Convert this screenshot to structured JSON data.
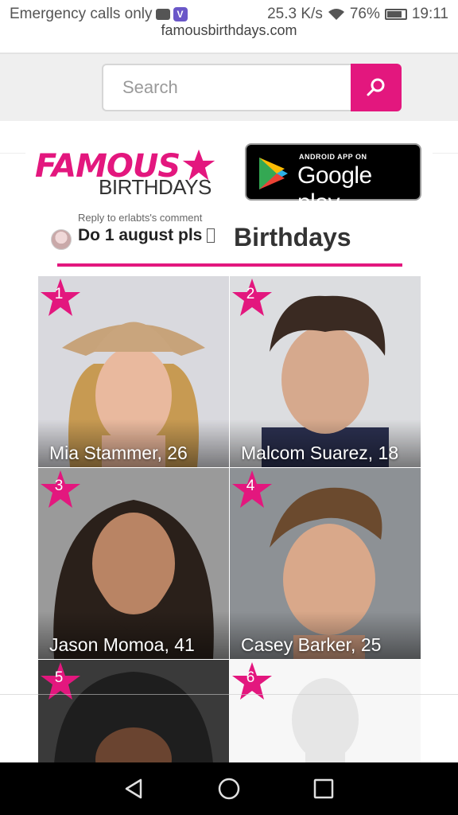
{
  "status_bar": {
    "left_text": "Emergency calls only",
    "speed": "25.3 K/s",
    "battery": "76%",
    "time": "19:11"
  },
  "url_peek": "famousbirthdays.com",
  "search": {
    "placeholder": "Search"
  },
  "ad": {
    "logo_top": "FAMOUS",
    "logo_bottom": "BIRTHDAYS",
    "store_small": "ANDROID APP ON",
    "store_big": "Google play"
  },
  "reply": {
    "label": "Reply to erlabts's comment",
    "text": "Do 1 august pls"
  },
  "section": {
    "title": "Birthdays"
  },
  "people": [
    {
      "rank": "1",
      "name": "Mia Stammer, 26"
    },
    {
      "rank": "2",
      "name": "Malcom Suarez, 18"
    },
    {
      "rank": "3",
      "name": "Jason Momoa, 41"
    },
    {
      "rank": "4",
      "name": "Casey Barker, 25"
    },
    {
      "rank": "5",
      "name": ""
    },
    {
      "rank": "6",
      "name": ""
    }
  ],
  "colors": {
    "accent": "#e3177e",
    "nav": "#000000"
  }
}
